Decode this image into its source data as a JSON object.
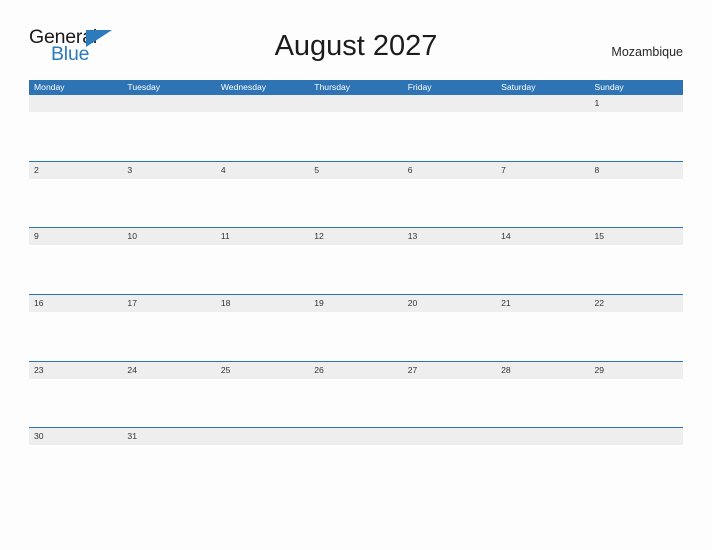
{
  "header": {
    "logo": {
      "text_top": "General",
      "text_bottom": "Blue",
      "triangle_icon": "triangle-icon",
      "color_dark": "#1a1a1a",
      "color_blue": "#2b7bbd"
    },
    "title": "August 2027",
    "location": "Mozambique"
  },
  "theme": {
    "header_blue": "#2e74b5",
    "row_band_gray": "#eeeeee",
    "page_background": "#fdfdfd",
    "day_number_color": "#333333"
  },
  "calendar": {
    "weekdays": [
      "Monday",
      "Tuesday",
      "Wednesday",
      "Thursday",
      "Friday",
      "Saturday",
      "Sunday"
    ],
    "weeks": [
      {
        "days": [
          {
            "label": "",
            "empty": true
          },
          {
            "label": "",
            "empty": true
          },
          {
            "label": "",
            "empty": true
          },
          {
            "label": "",
            "empty": true
          },
          {
            "label": "",
            "empty": true
          },
          {
            "label": "",
            "empty": true
          },
          {
            "label": "1",
            "empty": false
          }
        ]
      },
      {
        "days": [
          {
            "label": "2",
            "empty": false
          },
          {
            "label": "3",
            "empty": false
          },
          {
            "label": "4",
            "empty": false
          },
          {
            "label": "5",
            "empty": false
          },
          {
            "label": "6",
            "empty": false
          },
          {
            "label": "7",
            "empty": false
          },
          {
            "label": "8",
            "empty": false
          }
        ]
      },
      {
        "days": [
          {
            "label": "9",
            "empty": false
          },
          {
            "label": "10",
            "empty": false
          },
          {
            "label": "11",
            "empty": false
          },
          {
            "label": "12",
            "empty": false
          },
          {
            "label": "13",
            "empty": false
          },
          {
            "label": "14",
            "empty": false
          },
          {
            "label": "15",
            "empty": false
          }
        ]
      },
      {
        "days": [
          {
            "label": "16",
            "empty": false
          },
          {
            "label": "17",
            "empty": false
          },
          {
            "label": "18",
            "empty": false
          },
          {
            "label": "19",
            "empty": false
          },
          {
            "label": "20",
            "empty": false
          },
          {
            "label": "21",
            "empty": false
          },
          {
            "label": "22",
            "empty": false
          }
        ]
      },
      {
        "days": [
          {
            "label": "23",
            "empty": false
          },
          {
            "label": "24",
            "empty": false
          },
          {
            "label": "25",
            "empty": false
          },
          {
            "label": "26",
            "empty": false
          },
          {
            "label": "27",
            "empty": false
          },
          {
            "label": "28",
            "empty": false
          },
          {
            "label": "29",
            "empty": false
          }
        ]
      },
      {
        "days": [
          {
            "label": "30",
            "empty": false
          },
          {
            "label": "31",
            "empty": false
          },
          {
            "label": "",
            "empty": true
          },
          {
            "label": "",
            "empty": true
          },
          {
            "label": "",
            "empty": true
          },
          {
            "label": "",
            "empty": true
          },
          {
            "label": "",
            "empty": true
          }
        ]
      }
    ]
  }
}
